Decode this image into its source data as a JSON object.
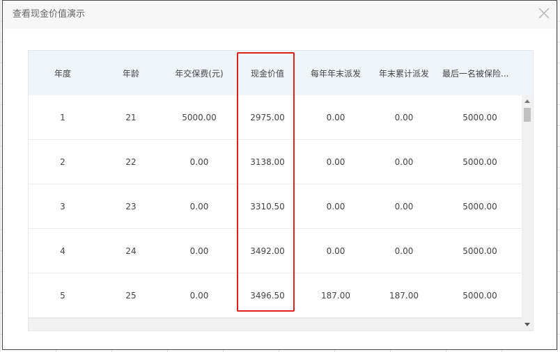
{
  "dialog": {
    "title": "查看现金价值演示"
  },
  "table": {
    "headers": [
      "年度",
      "年龄",
      "年交保费(元)",
      "现金价值",
      "每年年末派发",
      "年末累计派发",
      "最后一名被保险..."
    ],
    "rows": [
      [
        "1",
        "21",
        "5000.00",
        "2975.00",
        "0.00",
        "0.00",
        "5000.00"
      ],
      [
        "2",
        "22",
        "0.00",
        "3138.00",
        "0.00",
        "0.00",
        "5000.00"
      ],
      [
        "3",
        "23",
        "0.00",
        "3310.50",
        "0.00",
        "0.00",
        "5000.00"
      ],
      [
        "4",
        "24",
        "0.00",
        "3492.00",
        "0.00",
        "0.00",
        "5000.00"
      ],
      [
        "5",
        "25",
        "0.00",
        "3496.50",
        "187.00",
        "187.00",
        "5000.00"
      ]
    ]
  },
  "colors": {
    "highlight": "#e0201b",
    "header_bg": "#f0f5fb"
  }
}
